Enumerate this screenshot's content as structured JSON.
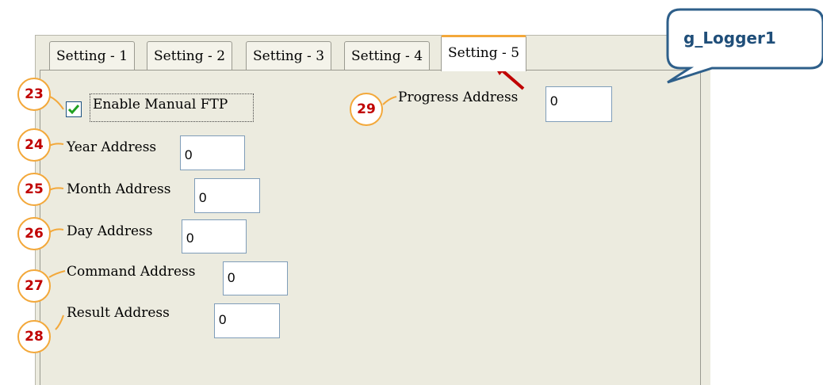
{
  "tabs": [
    {
      "label": "Setting - 1",
      "active": false
    },
    {
      "label": "Setting - 2",
      "active": false
    },
    {
      "label": "Setting - 3",
      "active": false
    },
    {
      "label": "Setting - 4",
      "active": false
    },
    {
      "label": "Setting - 5",
      "active": true
    }
  ],
  "enable_manual_ftp": {
    "label": "Enable Manual FTP",
    "checked": true
  },
  "fields": {
    "year": {
      "label": "Year Address",
      "value": "0"
    },
    "month": {
      "label": "Month Address",
      "value": "0"
    },
    "day": {
      "label": "Day Address",
      "value": "0"
    },
    "command": {
      "label": "Command Address",
      "value": "0"
    },
    "result": {
      "label": "Result Address",
      "value": "0"
    },
    "progress": {
      "label": "Progress Address",
      "value": "0"
    }
  },
  "badges": {
    "b23": "23",
    "b24": "24",
    "b25": "25",
    "b26": "26",
    "b27": "27",
    "b28": "28",
    "b29": "29"
  },
  "callout": {
    "text": "g_Logger1"
  },
  "colors": {
    "badge_border": "#f3a83a",
    "badge_text": "#c00000",
    "callout_border": "#2e5f8a",
    "callout_text": "#1f4e79",
    "arrow": "#c00000",
    "active_tab_accent": "#f3a83a",
    "panel_bg": "#ecebdf"
  }
}
